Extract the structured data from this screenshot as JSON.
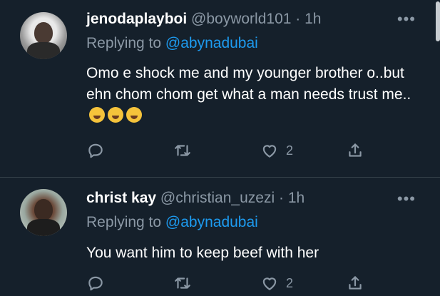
{
  "tweets": [
    {
      "name": "jenodaplayboi",
      "handle": "@boyworld101",
      "dot": "·",
      "time": "1h",
      "replying_prefix": "Replying to ",
      "replying_to": "@abynadubai",
      "text": "Omo e shock me and my younger brother o..but ehn chom chom get what a man needs trust me..",
      "like_count": "2",
      "more": "•••"
    },
    {
      "name": "christ kay",
      "handle": "@christian_uzezi",
      "dot": "·",
      "time": "1h",
      "replying_prefix": "Replying to ",
      "replying_to": "@abynadubai",
      "text": "You want him to keep beef with her",
      "like_count": "2",
      "more": "•••"
    }
  ],
  "icons": {
    "reply": "reply-icon",
    "retweet": "retweet-icon",
    "like": "like-icon",
    "share": "share-icon",
    "more": "more-icon",
    "emoji": "rolling-on-floor-laughing-emoji"
  },
  "colors": {
    "background": "#15202b",
    "link": "#1d9bf0",
    "secondary_text": "#8b98a5",
    "divider": "#38444d"
  }
}
